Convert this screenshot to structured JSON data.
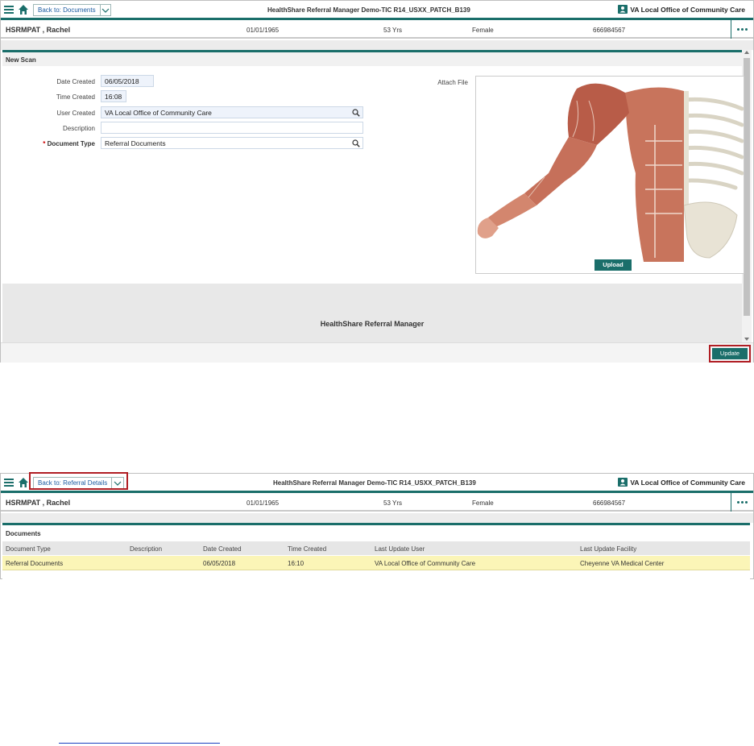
{
  "screen1": {
    "header": {
      "back_label": "Back to: Documents",
      "app_title": "HealthShare Referral Manager Demo-TIC R14_USXX_PATCH_B139",
      "facility": "VA Local Office of Community Care"
    },
    "patient": {
      "name": "HSRMPAT , Rachel",
      "dob": "01/01/1965",
      "age": "53 Yrs",
      "sex": "Female",
      "id": "666984567"
    },
    "panel_title": "New Scan",
    "form": {
      "date_created_label": "Date Created",
      "date_created_value": "06/05/2018",
      "time_created_label": "Time Created",
      "time_created_value": "16:08",
      "user_created_label": "User Created",
      "user_created_value": "VA Local Office of Community Care",
      "description_label": "Description",
      "description_value": "",
      "required_marker": "*",
      "document_type_label": "Document Type",
      "document_type_value": "Referral Documents",
      "attach_file_label": "Attach File",
      "upload_label": "Upload"
    },
    "footer_brand": "HealthShare Referral Manager",
    "update_label": "Update"
  },
  "screen2": {
    "header": {
      "back_label": "Back to: Referral Details",
      "app_title": "HealthShare Referral Manager Demo-TIC R14_USXX_PATCH_B139",
      "facility": "VA Local Office of Community Care"
    },
    "patient": {
      "name": "HSRMPAT , Rachel",
      "dob": "01/01/1965",
      "age": "53 Yrs",
      "sex": "Female",
      "id": "666984567"
    },
    "documents": {
      "title": "Documents",
      "columns": [
        "Document Type",
        "Description",
        "Date Created",
        "Time Created",
        "Last Update User",
        "Last Update Facility"
      ],
      "rows": [
        [
          "Referral Documents",
          "",
          "06/05/2018",
          "16:10",
          "VA Local Office of Community Care",
          "Cheyenne VA Medical Center"
        ]
      ]
    }
  },
  "colors": {
    "accent": "#1a6e6a",
    "highlight_border": "#b01e24",
    "selected_row": "#fbf5b7"
  },
  "icons": [
    "menu-icon",
    "home-icon",
    "chevron-down-icon",
    "facility-card-icon",
    "more-icon",
    "search-icon"
  ]
}
